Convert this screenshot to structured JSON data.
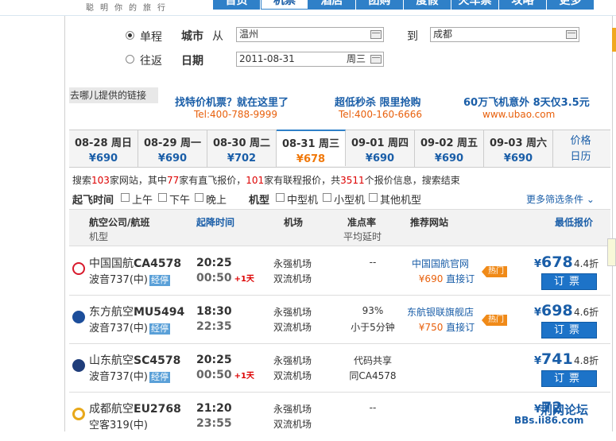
{
  "header": {
    "slogan": "聪明你的旅行",
    "tabs": [
      "首页",
      "机票",
      "酒店",
      "团购",
      "度假",
      "火车票",
      "攻略",
      "更多"
    ],
    "active_tab": 1
  },
  "search": {
    "trip_oneway": "单程",
    "trip_return": "往返",
    "city_label": "城市",
    "from_label": "从",
    "from_value": "温州",
    "to_label": "到",
    "to_value": "成都",
    "date_label": "日期",
    "date_value": "2011-08-31",
    "weekday": "周三"
  },
  "ads": {
    "link_label": "去哪儿提供的链接",
    "items": [
      {
        "title": "找特价机票？就在这里了",
        "phone": "Tel:400-788-9999"
      },
      {
        "title": "超低秒杀 限里抢购",
        "phone": "Tel:400-160-6666"
      },
      {
        "title": "60万飞机意外 8天仅3.5元",
        "phone": "www.ubao.com"
      }
    ]
  },
  "dates": [
    {
      "date": "08-28 周日",
      "price": "¥690"
    },
    {
      "date": "08-29 周一",
      "price": "¥690"
    },
    {
      "date": "08-30 周二",
      "price": "¥702"
    },
    {
      "date": "08-31 周三",
      "price": "¥678"
    },
    {
      "date": "09-01 周四",
      "price": "¥690"
    },
    {
      "date": "09-02 周五",
      "price": "¥690"
    },
    {
      "date": "09-03 周六",
      "price": "¥690"
    }
  ],
  "price_calendar": {
    "line1": "价格",
    "line2": "日历"
  },
  "summary": {
    "p1": "搜索",
    "n1": "103",
    "p2": "家网站，其中",
    "n2": "77",
    "p3": "家有直飞报价，",
    "n3": "101",
    "p4": "家有联程报价，共",
    "n4": "3511",
    "p5": "个报价信息，搜索结束"
  },
  "filters": {
    "departure_label": "起飞时间",
    "morning": "上午",
    "afternoon": "下午",
    "evening": "晚上",
    "type_label": "机型",
    "mid": "中型机",
    "small": "小型机",
    "other": "其他机型",
    "more": "更多筛选条件"
  },
  "table_header": {
    "airline": "航空公司/航班",
    "plane": "机型",
    "times": "起降时间",
    "airport": "机场",
    "ontime": "准点率",
    "delay": "平均延时",
    "site": "推荐网站",
    "price": "最低报价"
  },
  "flights": [
    {
      "airline": "中国国航",
      "flight": "CA4578",
      "plane": "波音737(中)",
      "badge": "经停",
      "dep": "20:25",
      "arr": "00:50",
      "plus": "+1天",
      "ap_dep": "永强机场",
      "ap_arr": "双流机场",
      "ontime1": "--",
      "ontime2": "",
      "site": "中国国航官网",
      "site_price": "¥690",
      "site_action": "直接订",
      "hot": "热门",
      "price": "678",
      "discount": "4.4折",
      "book": "订票",
      "logo_color": "#d8192b"
    },
    {
      "airline": "东方航空",
      "flight": "MU5494",
      "plane": "波音737(中)",
      "badge": "经停",
      "dep": "18:30",
      "arr": "22:35",
      "plus": "",
      "ap_dep": "永强机场",
      "ap_arr": "双流机场",
      "ontime1": "93%",
      "ontime2": "小于5分钟",
      "site": "东航银联旗舰店",
      "site_price": "¥750",
      "site_action": "直接订",
      "hot": "热门",
      "price": "698",
      "discount": "4.6折",
      "book": "订票",
      "logo_color": "#1c4e9b"
    },
    {
      "airline": "山东航空",
      "flight": "SC4578",
      "plane": "波音737(中)",
      "badge": "经停",
      "dep": "20:25",
      "arr": "00:50",
      "plus": "+1天",
      "ap_dep": "永强机场",
      "ap_arr": "双流机场",
      "ontime1": "代码共享",
      "ontime2": "同CA4578",
      "site": "",
      "site_price": "",
      "site_action": "",
      "hot": "",
      "price": "741",
      "discount": "4.8折",
      "book": "订票",
      "logo_color": "#1f3d7a"
    },
    {
      "airline": "成都航空",
      "flight": "EU2768",
      "plane": "空客319(中)",
      "badge": "",
      "dep": "21:20",
      "arr": "23:55",
      "plus": "",
      "ap_dep": "永强机场",
      "ap_arr": "双流机场",
      "ontime1": "--",
      "ontime2": "",
      "site": "",
      "site_price": "",
      "site_action": "",
      "hot": "",
      "price": "72",
      "discount": "",
      "book": "",
      "logo_color": "#e8a81a"
    }
  ],
  "watermark": {
    "line1": "荆网论坛",
    "line2": "BBs.ii86.com"
  }
}
